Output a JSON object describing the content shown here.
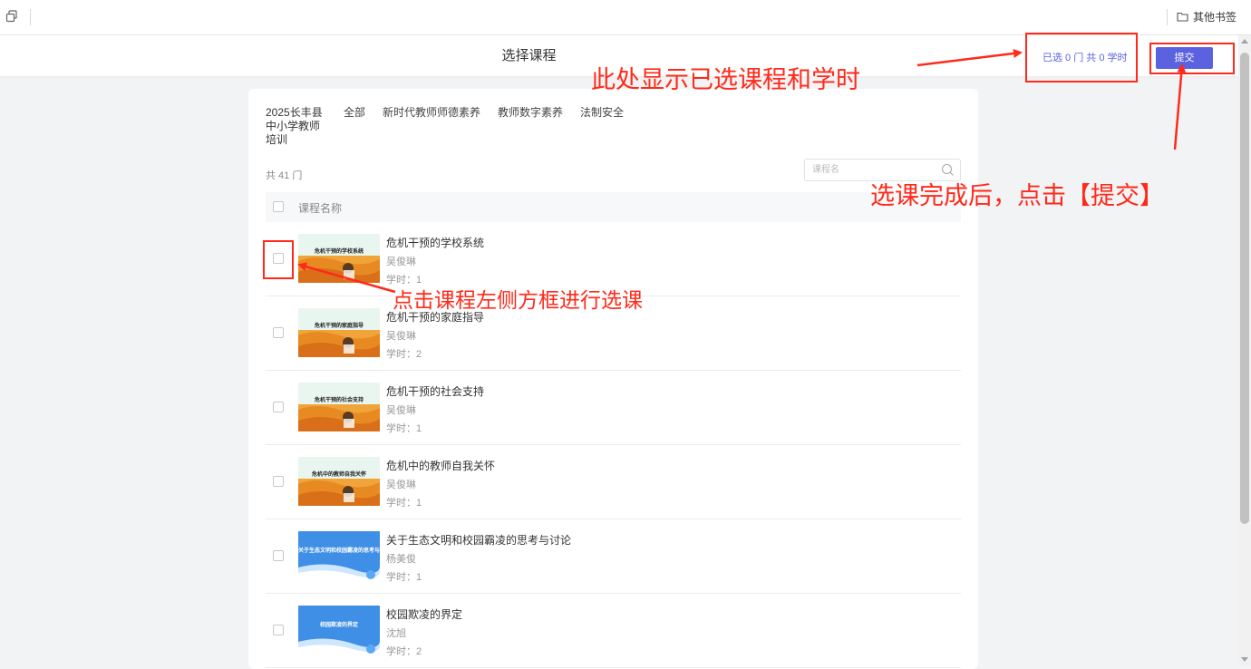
{
  "browser": {
    "bookmarks_icon": "copy-icon",
    "other_bookmarks": "其他书签",
    "folder_icon": "folder-icon"
  },
  "header": {
    "title": "选择课程",
    "selected_info": "已选 0 门 共 0 学时",
    "submit_label": "提交"
  },
  "filters": {
    "category_title": "2025长丰县中小学教师培训",
    "tabs": [
      "全部",
      "新时代教师师德素养",
      "教师数字素养",
      "法制安全"
    ],
    "total": "共 41 门",
    "search_placeholder": "课程名",
    "list_header": "课程名称"
  },
  "courses": [
    {
      "title": "危机干预的学校系统",
      "thumb_text": "危机干预的学校系统",
      "teacher": "吴俊琳",
      "hours": "学时：1",
      "thumb_style": "autumn"
    },
    {
      "title": "危机干预的家庭指导",
      "thumb_text": "危机干预的家庭指导",
      "teacher": "吴俊琳",
      "hours": "学时：2",
      "thumb_style": "autumn"
    },
    {
      "title": "危机干预的社会支持",
      "thumb_text": "危机干预的社会支持",
      "teacher": "吴俊琳",
      "hours": "学时：1",
      "thumb_style": "autumn"
    },
    {
      "title": "危机中的教师自我关怀",
      "thumb_text": "危机中的教师自我关怀",
      "teacher": "吴俊琳",
      "hours": "学时：1",
      "thumb_style": "autumn"
    },
    {
      "title": "关于生态文明和校园霸凌的思考与讨论",
      "thumb_text": "关于生态文明和校园霸凌的思考与讨论",
      "teacher": "杨美俊",
      "hours": "学时：1",
      "thumb_style": "blue"
    },
    {
      "title": "校园欺凌的界定",
      "thumb_text": "校园欺凌的界定",
      "teacher": "沈旭",
      "hours": "学时：2",
      "thumb_style": "blue"
    }
  ],
  "annotations": {
    "top": "此处显示已选课程和学时",
    "right": "选课完成后，点击【提交】",
    "left": "点击课程左侧方框进行选课"
  },
  "colors": {
    "accent": "#5a62e0",
    "annotation": "#ff2a1a",
    "background": "#f2f3f5"
  }
}
